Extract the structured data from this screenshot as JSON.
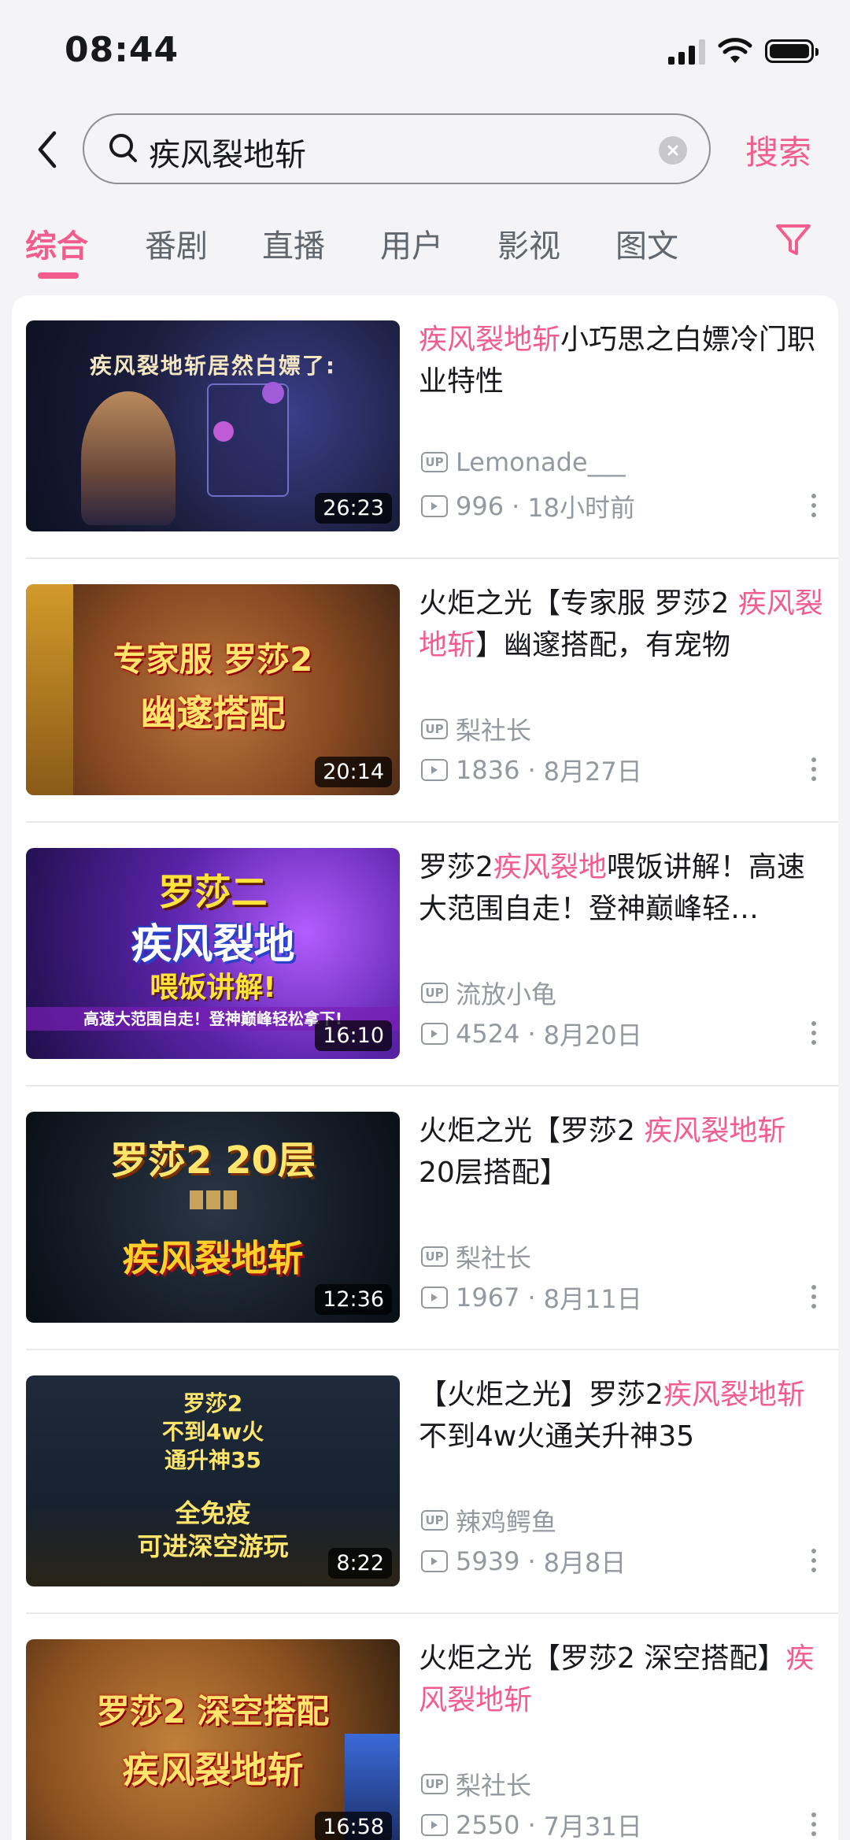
{
  "status_bar": {
    "time": "08:44"
  },
  "search": {
    "query": "疾风裂地斩",
    "button_label": "搜索"
  },
  "tabs": [
    {
      "label": "综合",
      "active": true
    },
    {
      "label": "番剧"
    },
    {
      "label": "直播"
    },
    {
      "label": "用户"
    },
    {
      "label": "影视"
    },
    {
      "label": "图文"
    }
  ],
  "colors": {
    "accent": "#f25d8e",
    "meta": "#9499a0"
  },
  "results": [
    {
      "title_parts": [
        {
          "text": "疾风裂地斩",
          "hl": true
        },
        {
          "text": "小巧思之白嫖冷门职业特性",
          "hl": false
        }
      ],
      "uploader": "Lemonade___",
      "views": "996",
      "date": "18小时前",
      "duration": "26:23",
      "thumb_text": "疾风裂地斩居然白嫖了:"
    },
    {
      "title_parts": [
        {
          "text": "火炬之光【专家服 罗莎2 ",
          "hl": false
        },
        {
          "text": "疾风裂地斩",
          "hl": true
        },
        {
          "text": "】幽邃搭配，有宠物",
          "hl": false
        }
      ],
      "uploader": "梨社长",
      "views": "1836",
      "date": "8月27日",
      "duration": "20:14",
      "thumb_text": "专家服 罗莎2",
      "thumb_text2": "幽邃搭配"
    },
    {
      "title_parts": [
        {
          "text": "罗莎2",
          "hl": false
        },
        {
          "text": "疾风裂地",
          "hl": true
        },
        {
          "text": "喂饭讲解！高速大范围自走！登神巅峰轻…",
          "hl": false
        }
      ],
      "uploader": "流放小龟",
      "views": "4524",
      "date": "8月20日",
      "duration": "16:10",
      "thumb_text": "罗莎二",
      "thumb_text2": "疾风裂地",
      "thumb_text3": "喂饭讲解!",
      "thumb_text4": "高速大范围自走！登神巅峰轻松拿下!"
    },
    {
      "title_parts": [
        {
          "text": "火炬之光【罗莎2 ",
          "hl": false
        },
        {
          "text": "疾风裂地斩",
          "hl": true
        },
        {
          "text": " 20层搭配】",
          "hl": false
        }
      ],
      "uploader": "梨社长",
      "views": "1967",
      "date": "8月11日",
      "duration": "12:36",
      "thumb_text": "罗莎2 20层",
      "thumb_text2": "疾风裂地斩"
    },
    {
      "title_parts": [
        {
          "text": "【火炬之光】罗莎2",
          "hl": false
        },
        {
          "text": "疾风裂地斩",
          "hl": true
        },
        {
          "text": "不到4w火通关升神35",
          "hl": false
        }
      ],
      "uploader": "辣鸡鳄鱼",
      "views": "5939",
      "date": "8月8日",
      "duration": "8:22",
      "thumb_text": "罗莎2",
      "thumb_text2": "不到4w火",
      "thumb_text3": "通升神35",
      "thumb_text4": "全免疫",
      "thumb_text5": "可进深空游玩"
    },
    {
      "title_parts": [
        {
          "text": "火炬之光【罗莎2 深空搭配】",
          "hl": false
        },
        {
          "text": "疾风裂地斩",
          "hl": true
        }
      ],
      "uploader": "梨社长",
      "views": "2550",
      "date": "7月31日",
      "duration": "16:58",
      "thumb_text": "罗莎2 深空搭配",
      "thumb_text2": "疾风裂地斩"
    }
  ]
}
